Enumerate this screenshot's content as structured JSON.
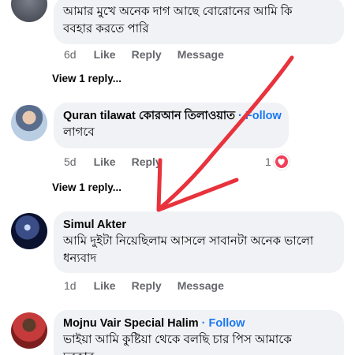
{
  "comments": [
    {
      "name": "",
      "text_line1": "আমার মুখে অনেক দাগ আছে  বোরোনের আমি কি",
      "text_line2": "ববহার করতে পারি",
      "time": "6d",
      "like": "Like",
      "reply": "Reply",
      "message": "Message",
      "view_replies": "View 1 reply..."
    },
    {
      "name": "Quran tilawat কোরআন তিলাওয়াত",
      "follow": "· Follow",
      "text_line1": "লাগবে",
      "time": "5d",
      "like": "Like",
      "reply": "Reply",
      "reaction_count": "1",
      "view_replies": "View 1 reply..."
    },
    {
      "name": "Simul Akter",
      "text_line1": "আমি দুইটা নিয়েছিলাম আসলে সাবানটা অনেক ভালো",
      "text_line2": "ধন্যবাদ",
      "time": "1d",
      "like": "Like",
      "reply": "Reply",
      "message": "Message"
    },
    {
      "name": "Mojnu Vair Special Halim",
      "follow": "· Follow",
      "text_line1": "ভাইয়া আমি কুষ্টিয়া থেকে বলছি চার পিস আমাকে",
      "text_line2": "দরকার"
    }
  ],
  "colors": {
    "bubble": "#f0f2f5",
    "follow": "#1877f2",
    "muted": "#65676b",
    "annotation_arrow": "#e8323c",
    "heart": "#f33e58"
  }
}
